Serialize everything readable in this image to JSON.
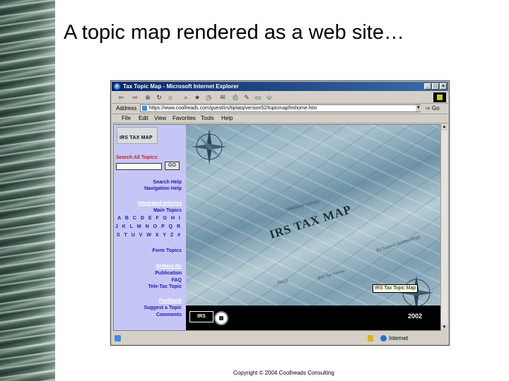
{
  "slide": {
    "title": "A topic map rendered as a web site…",
    "copyright": "Copyright © 2004 Coolheads Consulting"
  },
  "browser": {
    "window_title": "Tax Topic Map - Microsoft Internet Explorer",
    "window_buttons": [
      "_",
      "□",
      "×"
    ],
    "address_label": "Address",
    "address_url": "https://www.coolheads.com/guest/irs/tiplatq/version52/topicmap/tmhome.htm",
    "go_label": "Go",
    "menu": [
      "File",
      "Edit",
      "View",
      "Favorites",
      "Tools",
      "Help"
    ],
    "status_zone": "Internet"
  },
  "nav": {
    "logo_text": "IRS TAX MAP",
    "search_label": "Search All Topics:",
    "search_value": "",
    "search_button": "GO",
    "links": {
      "search_help": "Search Help",
      "navigation_help": "Navigation Help",
      "integrated_indexes": "Integrated Indexes",
      "main_topics": "Main Topics",
      "alpha_row1": "A B C D E F G H I",
      "alpha_row2": "J K L M N O P Q R",
      "alpha_row3": "S T U V W X Y Z #",
      "form_topics": "Form Topics",
      "browse_by": "Browse By",
      "publication": "Publication",
      "faq": "FAQ",
      "tele_tax": "Tele-Tax Topic",
      "feedback": "Feedback",
      "suggest": "Suggest a Topic",
      "comments": "Comments"
    }
  },
  "map": {
    "title": "IRS TAX MAP",
    "tooltip": "IRS Tax Topic Map",
    "footer_logo": "IRS",
    "year": "2002"
  }
}
